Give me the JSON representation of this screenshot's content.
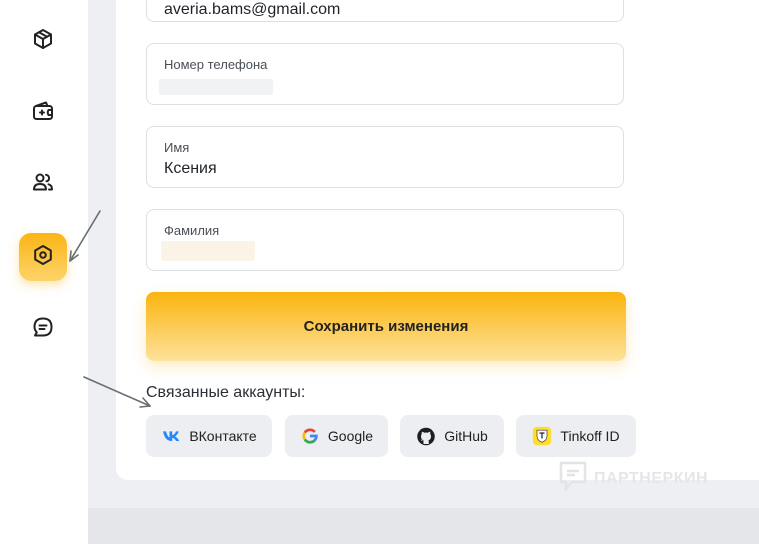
{
  "sidebar": {
    "items": [
      {
        "icon": "box-icon"
      },
      {
        "icon": "wallet-add-icon"
      },
      {
        "icon": "users-icon"
      },
      {
        "icon": "settings-hexagon-icon",
        "active": true
      },
      {
        "icon": "chat-icon"
      }
    ]
  },
  "form": {
    "email": {
      "value": "averia.bams@gmail.com"
    },
    "phone": {
      "label": "Номер телефона",
      "value": ""
    },
    "first_name": {
      "label": "Имя",
      "value": "Ксения"
    },
    "last_name": {
      "label": "Фамилия",
      "value": ""
    },
    "save_label": "Сохранить изменения"
  },
  "linked_accounts": {
    "title": "Связанные аккаунты:",
    "items": [
      {
        "label": "ВКонтакте",
        "icon": "vk-icon"
      },
      {
        "label": "Google",
        "icon": "google-icon"
      },
      {
        "label": "GitHub",
        "icon": "github-icon"
      },
      {
        "label": "Tinkoff ID",
        "icon": "tinkoff-icon"
      }
    ]
  },
  "watermark": {
    "text": "ПАРТНЕРКИН"
  },
  "colors": {
    "accent": "#fbb516",
    "background": "#edeff2",
    "button_bg": "#eceef1"
  }
}
